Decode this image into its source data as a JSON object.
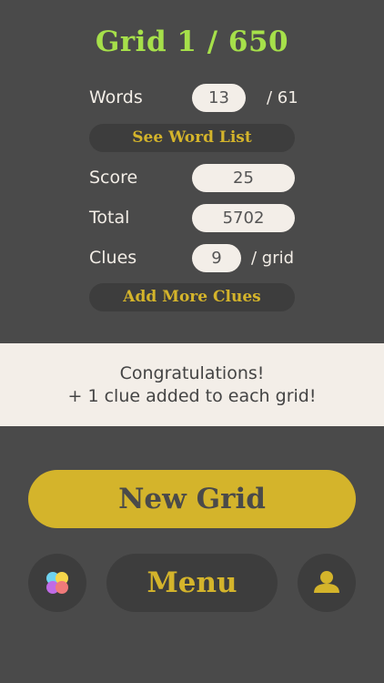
{
  "header": {
    "title": "Grid 1 / 650"
  },
  "stats": {
    "words": {
      "label": "Words",
      "value": "13",
      "suffix": "/ 61"
    },
    "score": {
      "label": "Score",
      "value": "25"
    },
    "total": {
      "label": "Total",
      "value": "5702"
    },
    "clues": {
      "label": "Clues",
      "value": "9",
      "suffix": "/ grid"
    }
  },
  "buttons": {
    "see_word_list": "See Word List",
    "add_more_clues": "Add More Clues",
    "new_grid": "New Grid",
    "menu": "Menu"
  },
  "banner": {
    "line1": "Congratulations!",
    "line2": "+ 1 clue added to each grid!"
  },
  "icons": {
    "left": "colorful-circles-icon",
    "right": "user-profile-icon"
  },
  "colors": {
    "background": "#4a4a4a",
    "title": "#a6e04a",
    "accent_gold": "#d4b42b",
    "pill": "#f3eee8",
    "dark_button": "#3d3d3d"
  }
}
